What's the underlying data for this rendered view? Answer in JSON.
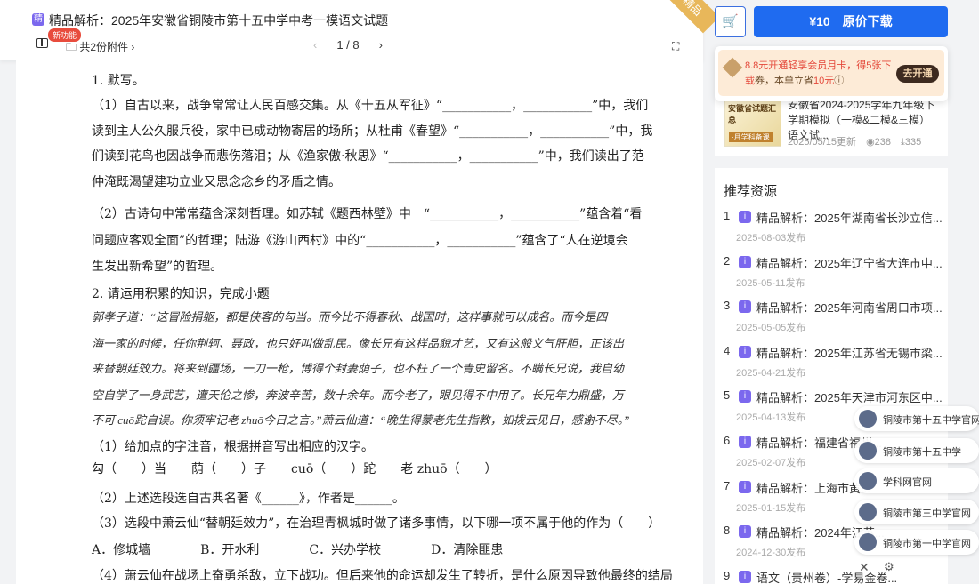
{
  "header": {
    "type_badge": "精",
    "title": "精品解析：2025年安徽省铜陵市第十五中学中考一模语文试题",
    "new_badge": "新功能",
    "attachments": "共2份附件 ›",
    "page": "1 / 8",
    "prev": "‹",
    "next": "›",
    "fullscreen": "⛶",
    "ribbon": "精品"
  },
  "actions": {
    "cart_icon": "🛒",
    "download": "¥10　原价下载"
  },
  "vip": {
    "text_a": "8.8元开通轻享会员月卡，得",
    "text_b": "5张下载",
    "text_c": "券，本单立省",
    "text_d": "10元",
    "text_e": "ⓘ",
    "button": "去开通"
  },
  "related": {
    "thumb_title": "安徽省试题汇总",
    "thumb_tag": "·月学科备课",
    "title": "安徽省2024-2025学年九年级下学期模拟（一模&二模&三模）语文试...",
    "date": "2025/05/15更新",
    "views": "238",
    "downloads": "335"
  },
  "recommend": {
    "heading": "推荐资源",
    "items": [
      {
        "num": "1",
        "title": "精品解析：2025年湖南省长沙立信...",
        "date": "2025-08-03发布"
      },
      {
        "num": "2",
        "title": "精品解析：2025年辽宁省大连市中...",
        "date": "2025-05-11发布"
      },
      {
        "num": "3",
        "title": "精品解析：2025年河南省周口市项...",
        "date": "2025-05-05发布"
      },
      {
        "num": "4",
        "title": "精品解析：2025年江苏省无锡市梁...",
        "date": "2025-04-21发布"
      },
      {
        "num": "5",
        "title": "精品解析：2025年天津市河东区中...",
        "date": "2025-04-13发布"
      },
      {
        "num": "6",
        "title": "精品解析：福建省福州...",
        "date": "2025-02-07发布"
      },
      {
        "num": "7",
        "title": "精品解析：上海市黄...",
        "date": "2025-01-15发布"
      },
      {
        "num": "8",
        "title": "精品解析：2024年江苏...",
        "date": "2024-12-30发布"
      },
      {
        "num": "9",
        "title": "语文（贵州卷）-学易金卷...",
        "date": ""
      }
    ]
  },
  "floats": [
    "铜陵市第十五中学官网",
    "铜陵市第十五中学",
    "学科网官网",
    "铜陵市第三中学官网",
    "铜陵市第一中学官网"
  ],
  "doc": {
    "lines": [
      "1. 默写。",
      "（1）自古以来，战争常常让人民百感交集。从《十五从军征》“___________，___________”中，我们",
      "读到主人公久服兵役，家中已成动物寄居的场所；从杜甫《春望》“___________，___________”中，我",
      "们读到花鸟也因战争而悲伤落泪；从《渔家傲·秋思》“___________，___________”中，我们读出了范",
      "仲淹既渴望建功立业又思念念乡的矛盾之情。",
      "（2）古诗句中常常蕴含深刻哲理。如苏轼《题西林壁》中　“___________，___________”蕴含着“看",
      "问题应客观全面”的哲理；陆游《游山西村》中的“___________，___________”蕴含了“人在逆境会",
      "生发出新希望”的哲理。",
      "2. 请运用积累的知识，完成小题",
      "郭孝子道：“这冒险捐躯，都是侠客的勾当。而今比不得春秋、战国时，这样事就可以成名。而今是四",
      "海一家的时候，任你荆轲、聂政，也只好叫做乱民。像长兄有这样品貌才艺，又有这般义气肝胆，正该出",
      "来替朝廷效力。将来到疆场，一刀一枪，博得个封妻荫子，也不枉了一个青史留名。不瞒长兄说，我自幼",
      "空自学了一身武艺，遭天伦之惨，奔波辛苦，数十余年。而今老了，眼见得不中用了。长兄年力鼎盛，万",
      "不可 cuō跎自误。你须牢记老 zhuō今日之言。”萧云仙道：“晚生得蒙老先生指教，如拨云见日，感谢不尽。”",
      "（1）给加点的字注音，根据拼音写出相应的汉字。",
      "勾（　　）当　　荫（　　）子　　cuō（　　）跎　　老 zhuō（　　）",
      "（2）上述选段选自古典名著《______》，作者是______。",
      "（3）选段中萧云仙“替朝廷效力”，在治理青枫城时做了诸多事情，以下哪一项不属于他的作为（　　）",
      "A．修城墙　　　　B．开水利　　　　C．兴办学校　　　　D．清除匪患",
      "（4）萧云仙在战场上奋勇杀敌，立下战功。但后来他的命运却发生了转折，是什么原因导致他最终的结局"
    ]
  },
  "bottom": {
    "close": "✕",
    "settings": "⚙"
  }
}
